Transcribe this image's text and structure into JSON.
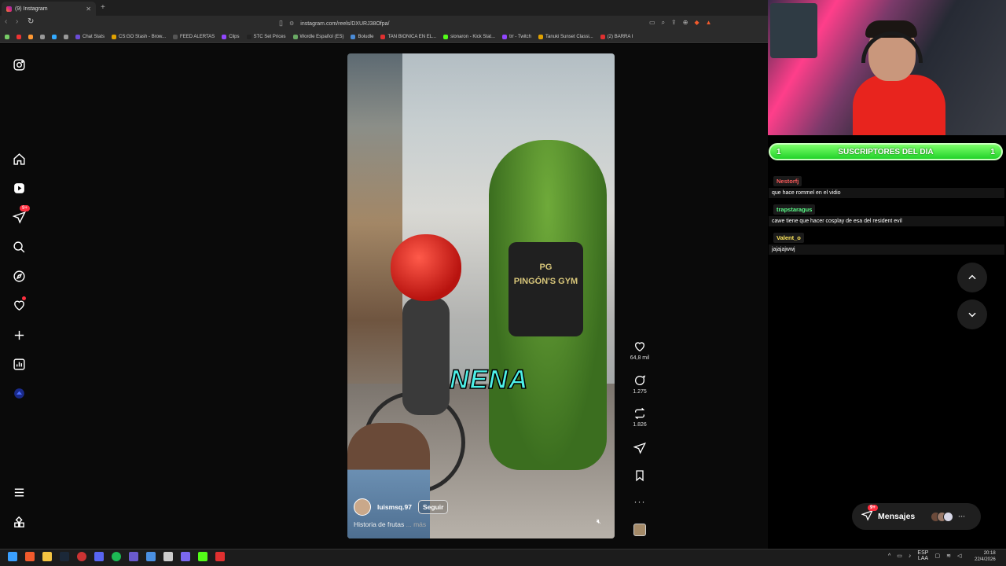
{
  "browser": {
    "tab_title": "(9) Instagram",
    "new_tab": "+",
    "url": "instagram.com/reels/DXURJ38Ofpa/",
    "bookmarks": [
      {
        "label": "Chat Stats",
        "color": "#6b4cd6"
      },
      {
        "label": "CS:GO Stash - Brow...",
        "color": "#e0a100"
      },
      {
        "label": "FEED ALERTAS",
        "color": "#555"
      },
      {
        "label": "Clips",
        "color": "#9146ff"
      },
      {
        "label": "STC Set Prices",
        "color": "#222"
      },
      {
        "label": "Wordle Español (ES)",
        "color": "#6aaa64"
      },
      {
        "label": "Boludle",
        "color": "#4a8bd6"
      },
      {
        "label": "TAN BIONICA EN EL...",
        "color": "#e03030"
      },
      {
        "label": "sionaron - Kick Stat...",
        "color": "#53fc18"
      },
      {
        "label": "trr - Twitch",
        "color": "#9146ff"
      },
      {
        "label": "Tanuki Sunset Classi...",
        "color": "#e0a100"
      },
      {
        "label": "(2) BARRA I",
        "color": "#e03030"
      }
    ]
  },
  "sidebar": {
    "items": [
      {
        "name": "instagram-logo-icon"
      },
      {
        "name": "home-icon"
      },
      {
        "name": "reels-icon"
      },
      {
        "name": "direct-messages-icon",
        "badge": "9+"
      },
      {
        "name": "search-icon"
      },
      {
        "name": "explore-icon"
      },
      {
        "name": "notifications-icon"
      },
      {
        "name": "create-icon"
      },
      {
        "name": "dashboard-icon"
      },
      {
        "name": "profile-avatar-icon"
      },
      {
        "name": "more-menu-icon"
      },
      {
        "name": "also-from-meta-icon"
      }
    ]
  },
  "reel": {
    "overlay_text": "NENA",
    "shirt_text": "PINGÓN'S GYM",
    "shirt_logo": "PG",
    "username": "luismsq.97",
    "follow_label": "Seguir",
    "caption": "Historia de frutas",
    "caption_more": "... más",
    "likes": "64,8 mil",
    "comments": "1.275",
    "reposts": "1.826"
  },
  "messages": {
    "label": "Mensajes",
    "badge": "9+"
  },
  "stream": {
    "subs_label": "SUSCRIPTORES DEL DIA",
    "subs_left": "1",
    "subs_right": "1",
    "chat": [
      {
        "user": "Nestorfj",
        "user_color": "#ff5c5c",
        "text": "que hace rommel en el vidio"
      },
      {
        "user": "trapstaragus",
        "user_color": "#5cff8a",
        "text": "cawe tiene que hacer cosplay de esa del resident evil"
      },
      {
        "user": "Valent_o",
        "user_color": "#ffe75c",
        "text": "jajajajwwj"
      }
    ]
  },
  "taskbar": {
    "lang": "ESP",
    "lang_sub": "LAA",
    "time": "20:18",
    "date": "22/4/2026"
  }
}
